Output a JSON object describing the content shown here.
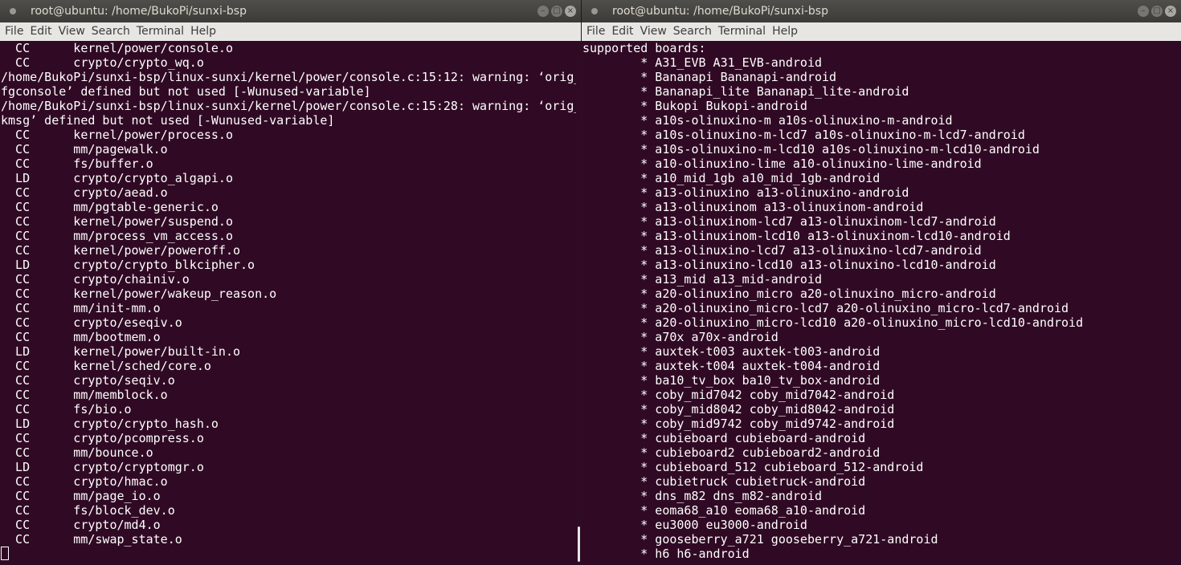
{
  "menu": [
    "File",
    "Edit",
    "View",
    "Search",
    "Terminal",
    "Help"
  ],
  "left": {
    "title": "root@ubuntu: /home/BukoPi/sunxi-bsp",
    "lines": [
      "  CC      kernel/power/console.o",
      "  CC      crypto/crypto_wq.o",
      "/home/BukoPi/sunxi-bsp/linux-sunxi/kernel/power/console.c:15:12: warning: ‘orig_",
      "fgconsole’ defined but not used [-Wunused-variable]",
      "/home/BukoPi/sunxi-bsp/linux-sunxi/kernel/power/console.c:15:28: warning: ‘orig_",
      "kmsg’ defined but not used [-Wunused-variable]",
      "  CC      kernel/power/process.o",
      "  CC      mm/pagewalk.o",
      "  CC      fs/buffer.o",
      "  LD      crypto/crypto_algapi.o",
      "  CC      crypto/aead.o",
      "  CC      mm/pgtable-generic.o",
      "  CC      kernel/power/suspend.o",
      "  CC      mm/process_vm_access.o",
      "  CC      kernel/power/poweroff.o",
      "  LD      crypto/crypto_blkcipher.o",
      "  CC      crypto/chainiv.o",
      "  CC      kernel/power/wakeup_reason.o",
      "  CC      mm/init-mm.o",
      "  CC      crypto/eseqiv.o",
      "  CC      mm/bootmem.o",
      "  LD      kernel/power/built-in.o",
      "  CC      kernel/sched/core.o",
      "  CC      crypto/seqiv.o",
      "  CC      mm/memblock.o",
      "  CC      fs/bio.o",
      "  LD      crypto/crypto_hash.o",
      "  CC      crypto/pcompress.o",
      "  CC      mm/bounce.o",
      "  LD      crypto/cryptomgr.o",
      "  CC      crypto/hmac.o",
      "  CC      mm/page_io.o",
      "  CC      fs/block_dev.o",
      "  CC      crypto/md4.o",
      "  CC      mm/swap_state.o"
    ]
  },
  "right": {
    "title": "root@ubuntu: /home/BukoPi/sunxi-bsp",
    "lines": [
      "supported boards:",
      "        * A31_EVB A31_EVB-android",
      "        * Bananapi Bananapi-android",
      "        * Bananapi_lite Bananapi_lite-android",
      "        * Bukopi Bukopi-android",
      "        * a10s-olinuxino-m a10s-olinuxino-m-android",
      "        * a10s-olinuxino-m-lcd7 a10s-olinuxino-m-lcd7-android",
      "        * a10s-olinuxino-m-lcd10 a10s-olinuxino-m-lcd10-android",
      "        * a10-olinuxino-lime a10-olinuxino-lime-android",
      "        * a10_mid_1gb a10_mid_1gb-android",
      "        * a13-olinuxino a13-olinuxino-android",
      "        * a13-olinuxinom a13-olinuxinom-android",
      "        * a13-olinuxinom-lcd7 a13-olinuxinom-lcd7-android",
      "        * a13-olinuxinom-lcd10 a13-olinuxinom-lcd10-android",
      "        * a13-olinuxino-lcd7 a13-olinuxino-lcd7-android",
      "        * a13-olinuxino-lcd10 a13-olinuxino-lcd10-android",
      "        * a13_mid a13_mid-android",
      "        * a20-olinuxino_micro a20-olinuxino_micro-android",
      "        * a20-olinuxino_micro-lcd7 a20-olinuxino_micro-lcd7-android",
      "        * a20-olinuxino_micro-lcd10 a20-olinuxino_micro-lcd10-android",
      "        * a70x a70x-android",
      "        * auxtek-t003 auxtek-t003-android",
      "        * auxtek-t004 auxtek-t004-android",
      "        * ba10_tv_box ba10_tv_box-android",
      "        * coby_mid7042 coby_mid7042-android",
      "        * coby_mid8042 coby_mid8042-android",
      "        * coby_mid9742 coby_mid9742-android",
      "        * cubieboard cubieboard-android",
      "        * cubieboard2 cubieboard2-android",
      "        * cubieboard_512 cubieboard_512-android",
      "        * cubietruck cubietruck-android",
      "        * dns_m82 dns_m82-android",
      "        * eoma68_a10 eoma68_a10-android",
      "        * eu3000 eu3000-android",
      "        * gooseberry_a721 gooseberry_a721-android",
      "        * h6 h6-android"
    ]
  }
}
